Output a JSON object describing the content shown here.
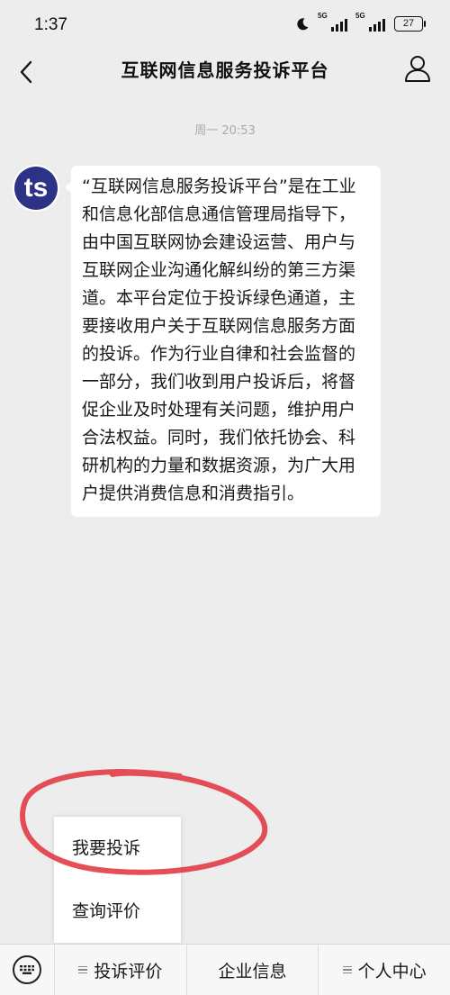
{
  "status_bar": {
    "time": "1:37",
    "network_1": "5G",
    "network_2": "5G",
    "battery": "27",
    "icons": [
      "moon-icon",
      "signal-icon",
      "signal-icon",
      "battery-icon"
    ]
  },
  "nav": {
    "title": "互联网信息服务投诉平台",
    "back_icon": "chevron-left-icon",
    "profile_icon": "user-icon"
  },
  "chat": {
    "timestamp": "周一 20:53",
    "avatar_text": "ts",
    "message": "“互联网信息服务投诉平台”是在工业和信息化部信息通信管理局指导下，由中国互联网协会建设运营、用户与互联网企业沟通化解纠纷的第三方渠道。本平台定位于投诉绿色通道，主要接收用户关于互联网信息服务方面的投诉。作为行业自律和社会监督的一部分，我们收到用户投诉后，将督促企业及时处理有关问题，维护用户合法权益。同时，我们依托协会、科研机构的力量和数据资源，为广大用户提供消费信息和消费指引。"
  },
  "popup_menu": {
    "items": [
      "我要投诉",
      "查询评价"
    ]
  },
  "bottom_menu": {
    "keyboard_icon": "keyboard-icon",
    "tabs": [
      "投诉评价",
      "企业信息",
      "个人中心"
    ]
  },
  "colors": {
    "background": "#ededed",
    "bubble": "#ffffff",
    "avatar": "#2d3286",
    "annotation": "#e0303a"
  }
}
